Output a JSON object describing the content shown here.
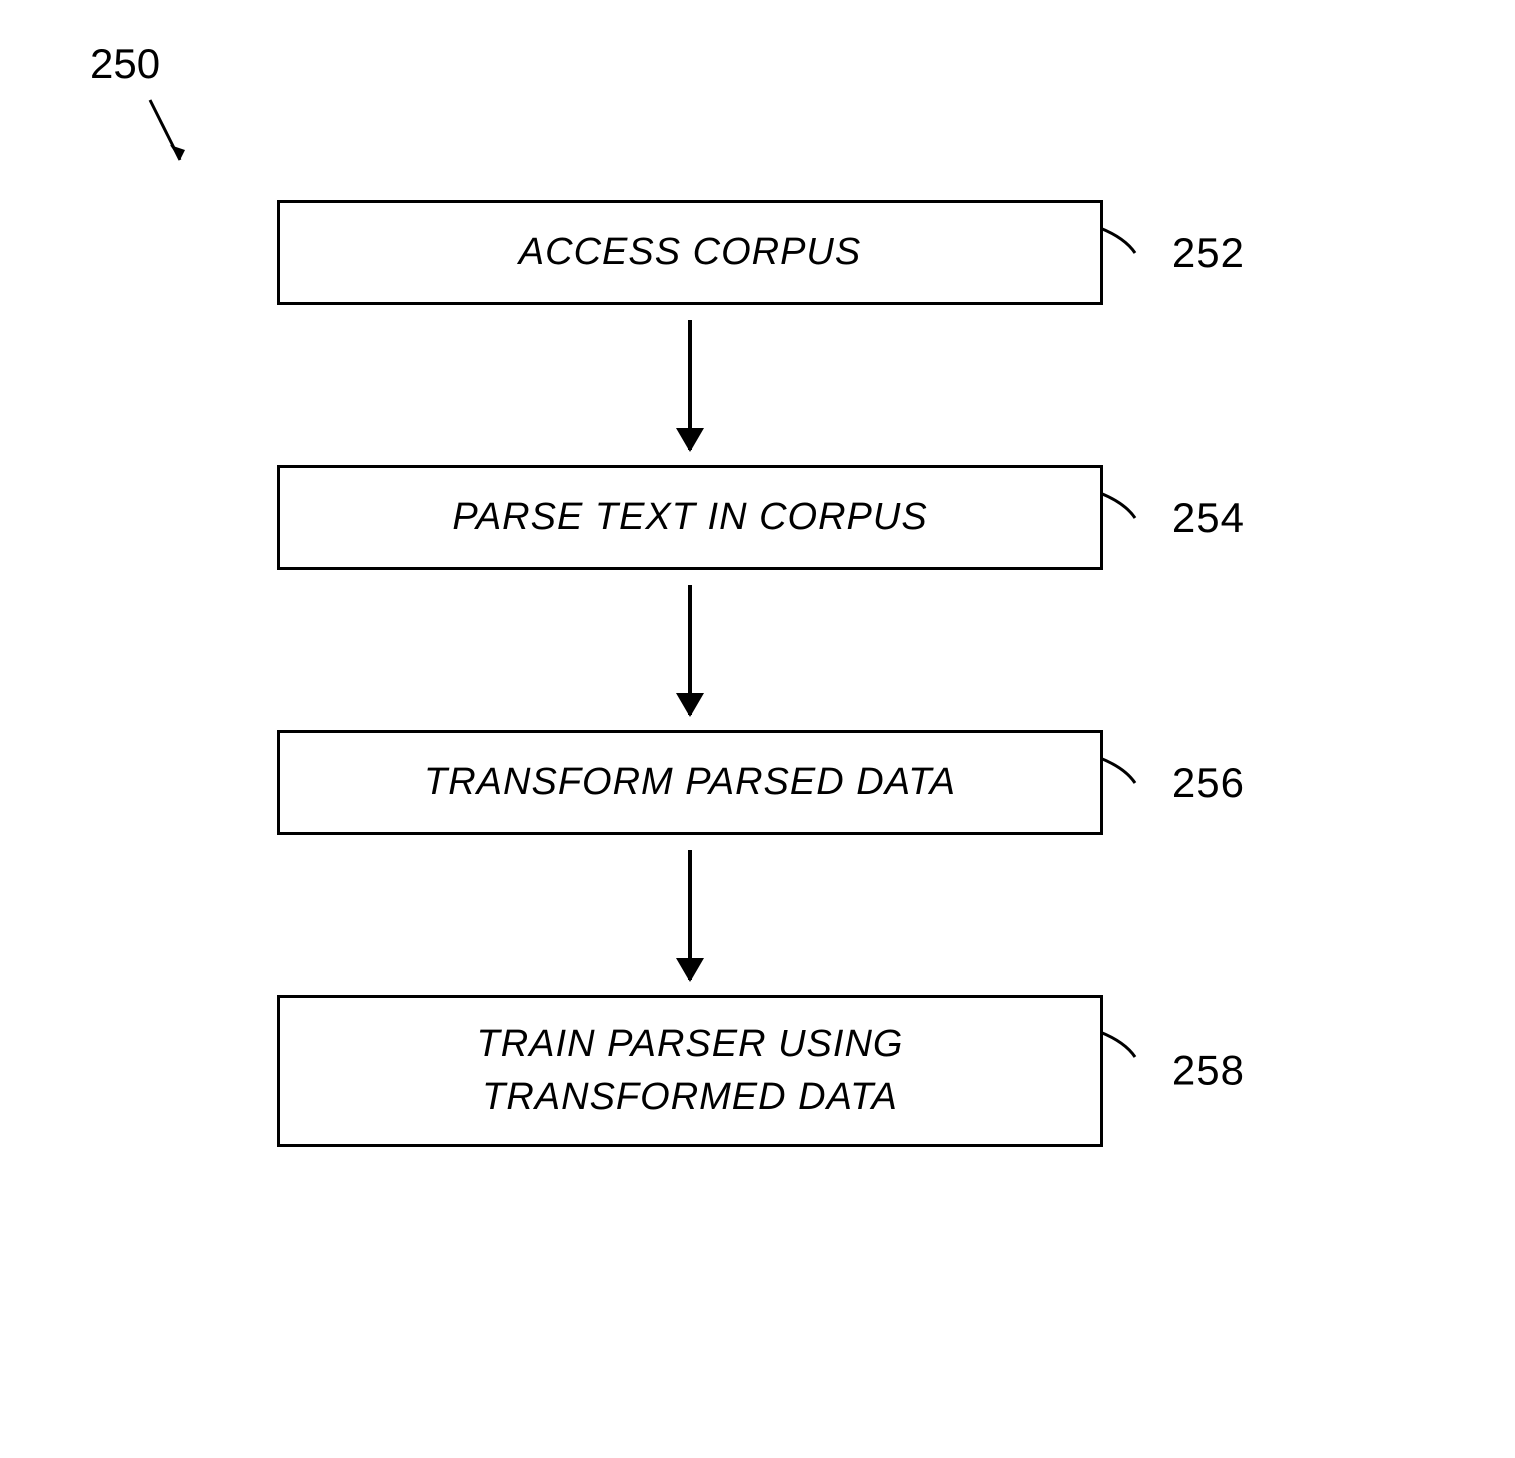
{
  "figure_number": "250",
  "steps": [
    {
      "text": "ACCESS CORPUS",
      "label": "252"
    },
    {
      "text": "PARSE TEXT IN CORPUS",
      "label": "254"
    },
    {
      "text": "TRANSFORM PARSED DATA",
      "label": "256"
    },
    {
      "text": "TRAIN PARSER USING\nTRANSFORMED DATA",
      "label": "258"
    }
  ]
}
